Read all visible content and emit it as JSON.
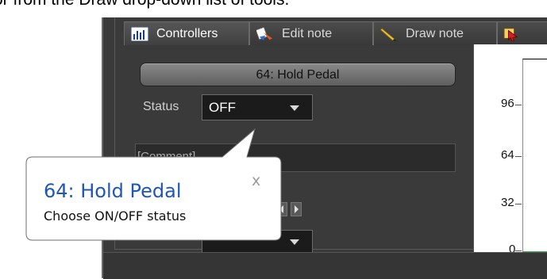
{
  "caption_fragment": "or from the Draw drop-down list of tools.",
  "tabs": [
    {
      "label": "Controllers",
      "icon": "controllers-icon",
      "active": true
    },
    {
      "label": "Edit note",
      "icon": "edit-note-icon",
      "active": false
    },
    {
      "label": "Draw note",
      "icon": "draw-note-icon",
      "active": false
    },
    {
      "label": "",
      "icon": "select-tool-icon",
      "active": false
    }
  ],
  "controller": {
    "button_label": "64: Hold Pedal",
    "status_label": "Status",
    "status_value": "OFF",
    "comment_text": "[Comment]"
  },
  "graph": {
    "y_ticks": [
      "96",
      "64",
      "32",
      "0"
    ],
    "line_color": "#2fb34a"
  },
  "tooltip": {
    "title": "64: Hold Pedal",
    "description": "Choose ON/OFF status",
    "close_label": "x",
    "title_color": "#1f56b8"
  }
}
